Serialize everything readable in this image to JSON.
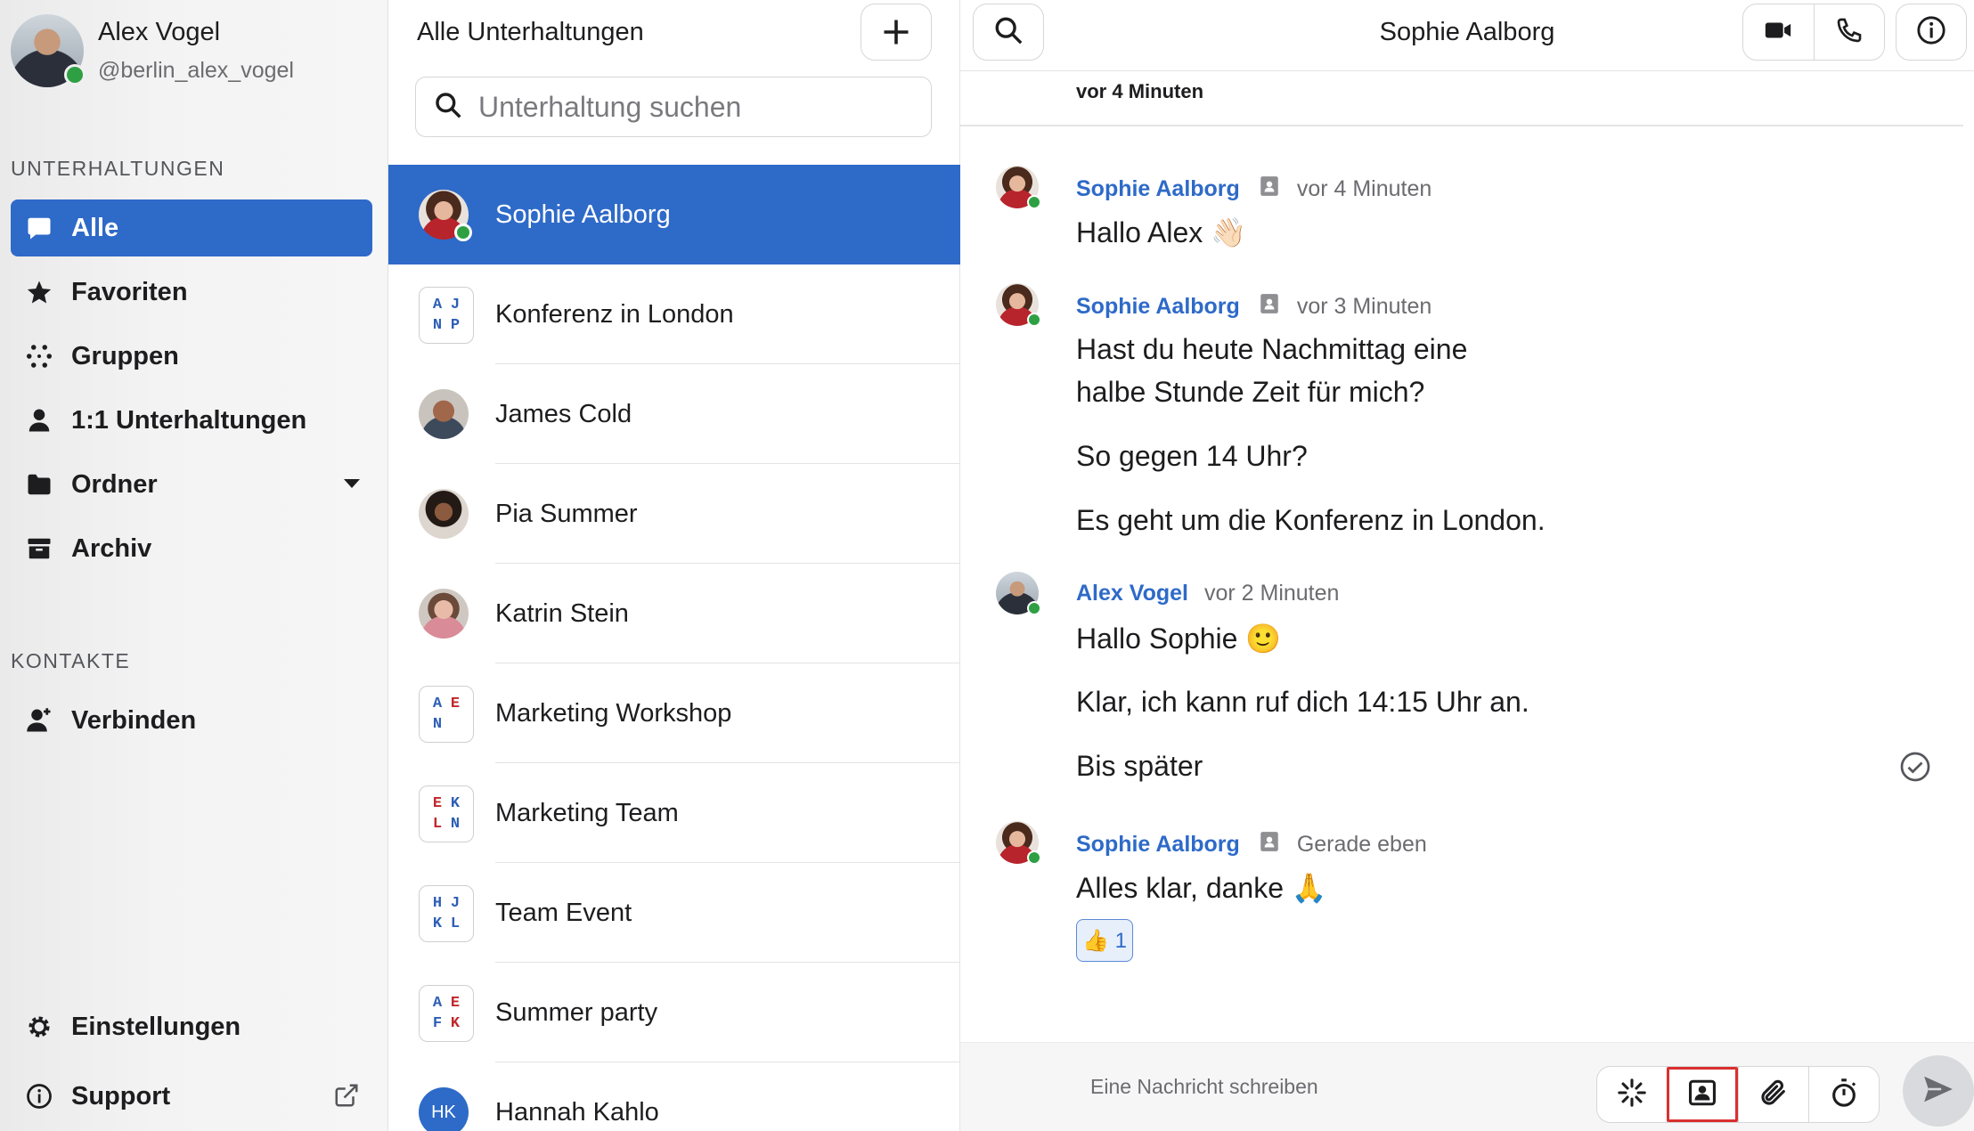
{
  "profile": {
    "name": "Alex Vogel",
    "handle": "@berlin_alex_vogel"
  },
  "sidebar": {
    "section_conversations": "UNTERHALTUNGEN",
    "items": [
      {
        "label": "Alle",
        "icon": "chat-bubble-icon",
        "active": true
      },
      {
        "label": "Favoriten",
        "icon": "star-icon"
      },
      {
        "label": "Gruppen",
        "icon": "groups-icon"
      },
      {
        "label": "1:1 Unterhaltungen",
        "icon": "person-icon"
      },
      {
        "label": "Ordner",
        "icon": "folder-icon"
      },
      {
        "label": "Archiv",
        "icon": "archive-icon"
      }
    ],
    "section_contacts": "KONTAKTE",
    "connect_label": "Verbinden",
    "settings_label": "Einstellungen",
    "support_label": "Support"
  },
  "conversation_list": {
    "title": "Alle Unterhaltungen",
    "search_placeholder": "Unterhaltung suchen",
    "items": [
      {
        "name": "Sophie Aalborg",
        "type": "user",
        "active": true
      },
      {
        "name": "Konferenz in London",
        "type": "group",
        "initials": [
          "A",
          "J",
          "N",
          "P"
        ]
      },
      {
        "name": "James Cold",
        "type": "user"
      },
      {
        "name": "Pia Summer",
        "type": "user"
      },
      {
        "name": "Katrin Stein",
        "type": "user"
      },
      {
        "name": "Marketing Workshop",
        "type": "group",
        "initials": [
          "A",
          "E",
          "N",
          ""
        ]
      },
      {
        "name": "Marketing Team",
        "type": "group",
        "initials": [
          "E",
          "K",
          "L",
          "N"
        ],
        "muted": true
      },
      {
        "name": "Team Event",
        "type": "group",
        "initials": [
          "H",
          "J",
          "K",
          "L"
        ]
      },
      {
        "name": "Summer party",
        "type": "group",
        "initials": [
          "A",
          "E",
          "F",
          "K"
        ]
      },
      {
        "name": "Hannah Kahlo",
        "type": "user",
        "avatar_text": "HK"
      }
    ]
  },
  "chat": {
    "title": "Sophie Aalborg",
    "date_separator": "vor 4 Minuten",
    "messages": [
      {
        "sender": "Sophie Aalborg",
        "time": "vor 4 Minuten",
        "lines": [
          "Hallo Alex 👋🏻"
        ]
      },
      {
        "sender": "Sophie Aalborg",
        "time": "vor 3 Minuten",
        "lines": [
          "Hast du heute Nachmittag eine",
          "halbe Stunde Zeit für mich?",
          "So gegen 14 Uhr?",
          "Es geht um die Konferenz in London."
        ]
      },
      {
        "sender": "Alex Vogel",
        "time": "vor 2 Minuten",
        "lines": [
          "Hallo Sophie 🙂",
          "Klar, ich kann ruf dich 14:15 Uhr an.",
          "Bis später"
        ]
      },
      {
        "sender": "Sophie Aalborg",
        "time": "Gerade eben",
        "lines": [
          "Alles klar, danke 🙏"
        ],
        "reaction": "👍 1"
      }
    ],
    "composer_placeholder": "Eine Nachricht schreiben"
  },
  "colors": {
    "accent": "#2e6ac8",
    "online": "#2ea043",
    "highlight": "#d9302f"
  }
}
